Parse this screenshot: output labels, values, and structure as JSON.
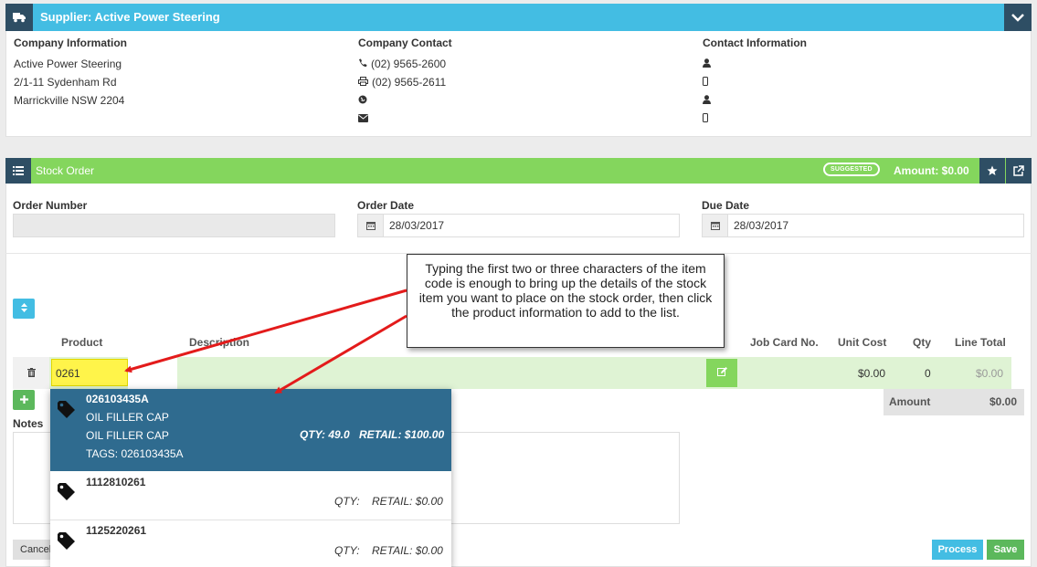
{
  "supplier": {
    "title": "Supplier: Active Power Steering",
    "company_info": {
      "heading": "Company Information",
      "lines": [
        "Active Power Steering",
        "2/1-11 Sydenham Rd",
        "Marrickville NSW 2204"
      ]
    },
    "company_contact": {
      "heading": "Company Contact",
      "phone": "(02) 9565-2600",
      "fax": "(02) 9565-2611"
    },
    "contact_info": {
      "heading": "Contact Information"
    }
  },
  "stock_order": {
    "title": "Stock Order",
    "badge": "SUGGESTED",
    "amount": "Amount: $0.00",
    "order_number_label": "Order Number",
    "order_number_value": "",
    "order_date_label": "Order Date",
    "order_date_value": "28/03/2017",
    "due_date_label": "Due Date",
    "due_date_value": "28/03/2017",
    "columns": {
      "product": "Product",
      "description": "Description",
      "job_card": "Job Card No.",
      "unit_cost": "Unit Cost",
      "qty": "Qty",
      "line_total": "Line Total"
    },
    "line": {
      "product": "0261",
      "unit_cost": "$0.00",
      "qty": "0",
      "line_total": "$0.00"
    },
    "amount_label": "Amount",
    "amount_value": "$0.00",
    "notes_label": "Notes",
    "cancel_label": "Cancel",
    "process_label": "Process",
    "save_label": "Save"
  },
  "dropdown": {
    "items": [
      {
        "code": "026103435A",
        "line1": "OIL FILLER CAP",
        "line2": "OIL FILLER CAP",
        "tags": "TAGS: 026103435A",
        "qty": "QTY: 49.0",
        "retail": "RETAIL: $100.00"
      },
      {
        "code": "1112810261",
        "qty": "QTY:",
        "retail": "RETAIL: $0.00"
      },
      {
        "code": "1125220261",
        "qty": "QTY:",
        "retail": "RETAIL: $0.00"
      }
    ]
  },
  "callout": {
    "text": "Typing the first two or three characters of the item code is enough to bring up the details of the stock item you want to place on the stock order, then click the product information to add to the list."
  },
  "icons": {
    "supplier_header": "truck-icon",
    "collapse": "chevron-down-icon",
    "stock_order_header": "list-icon",
    "favourite": "star-icon",
    "open_external": "external-link-icon",
    "phone": "phone-icon",
    "fax": "printer-icon",
    "website": "globe-icon",
    "email": "envelope-icon",
    "contact_person": "user-icon",
    "contact_mobile": "mobile-icon",
    "date": "calendar-icon",
    "sort": "sort-icon",
    "delete": "trash-icon",
    "edit": "edit-icon",
    "add_line": "plus-icon",
    "product_tag": "tag-icon"
  },
  "colors": {
    "supplier_header": "#43bde3",
    "stock_order_header": "#84d65d",
    "dark_icon_box": "#2e4e64",
    "selected_item": "#2f6b8f",
    "product_highlight": "#fff44a",
    "arrow": "#e31b1b"
  }
}
